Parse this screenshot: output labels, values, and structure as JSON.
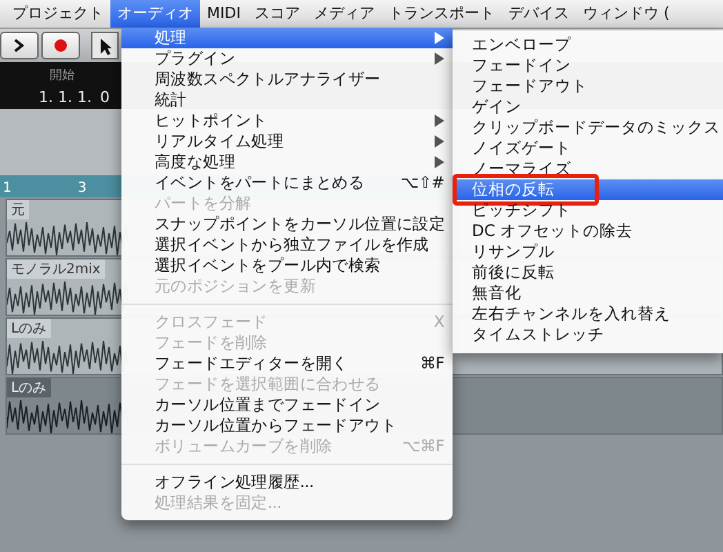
{
  "menubar": [
    {
      "label": "プロジェクト",
      "selected": false
    },
    {
      "label": "オーディオ",
      "selected": true
    },
    {
      "label": "MIDI",
      "selected": false
    },
    {
      "label": "スコア",
      "selected": false
    },
    {
      "label": "メディア",
      "selected": false
    },
    {
      "label": "トランスポート",
      "selected": false
    },
    {
      "label": "デバイス",
      "selected": false
    },
    {
      "label": "ウィンドウ (",
      "selected": false
    }
  ],
  "transport": {
    "start_label": "開始",
    "start_value": "1. 1. 1.",
    "start_ticks": "0"
  },
  "ruler": [
    "1",
    "3"
  ],
  "tracks": [
    {
      "label": "元",
      "selected": false
    },
    {
      "label": "モノラル2mix",
      "selected": false
    },
    {
      "label": "Lのみ",
      "selected": false
    },
    {
      "label": "Lのみ",
      "selected": true
    }
  ],
  "audio_menu": [
    {
      "kind": "item",
      "label": "処理",
      "has_submenu": true,
      "disabled": false,
      "selected": true
    },
    {
      "kind": "item",
      "label": "プラグイン",
      "has_submenu": true,
      "disabled": false,
      "selected": false
    },
    {
      "kind": "item",
      "label": "周波数スペクトルアナライザー",
      "has_submenu": false,
      "disabled": false,
      "selected": false
    },
    {
      "kind": "item",
      "label": "統計",
      "has_submenu": false,
      "disabled": false,
      "selected": false
    },
    {
      "kind": "item",
      "label": "ヒットポイント",
      "has_submenu": true,
      "disabled": false,
      "selected": false
    },
    {
      "kind": "item",
      "label": "リアルタイム処理",
      "has_submenu": true,
      "disabled": false,
      "selected": false
    },
    {
      "kind": "item",
      "label": "高度な処理",
      "has_submenu": true,
      "disabled": false,
      "selected": false
    },
    {
      "kind": "item",
      "label": "イベントをパートにまとめる",
      "shortcut": "⌥⇧#",
      "has_submenu": false,
      "disabled": false,
      "selected": false
    },
    {
      "kind": "item",
      "label": "パートを分解",
      "has_submenu": false,
      "disabled": true,
      "selected": false
    },
    {
      "kind": "item",
      "label": "スナップポイントをカーソル位置に設定",
      "has_submenu": false,
      "disabled": false,
      "selected": false
    },
    {
      "kind": "item",
      "label": "選択イベントから独立ファイルを作成",
      "has_submenu": false,
      "disabled": false,
      "selected": false
    },
    {
      "kind": "item",
      "label": "選択イベントをプール内で検索",
      "has_submenu": false,
      "disabled": false,
      "selected": false
    },
    {
      "kind": "item",
      "label": "元のポジションを更新",
      "has_submenu": false,
      "disabled": true,
      "selected": false
    },
    {
      "kind": "separator"
    },
    {
      "kind": "item",
      "label": "クロスフェード",
      "shortcut": "X",
      "has_submenu": false,
      "disabled": true,
      "selected": false
    },
    {
      "kind": "item",
      "label": "フェードを削除",
      "has_submenu": false,
      "disabled": true,
      "selected": false
    },
    {
      "kind": "item",
      "label": "フェードエディターを開く",
      "shortcut": "⌘F",
      "has_submenu": false,
      "disabled": false,
      "selected": false
    },
    {
      "kind": "item",
      "label": "フェードを選択範囲に合わせる",
      "has_submenu": false,
      "disabled": true,
      "selected": false
    },
    {
      "kind": "item",
      "label": "カーソル位置までフェードイン",
      "has_submenu": false,
      "disabled": false,
      "selected": false
    },
    {
      "kind": "item",
      "label": "カーソル位置からフェードアウト",
      "has_submenu": false,
      "disabled": false,
      "selected": false
    },
    {
      "kind": "item",
      "label": "ボリュームカーブを削除",
      "shortcut": "⌥⌘F",
      "has_submenu": false,
      "disabled": true,
      "selected": false
    },
    {
      "kind": "separator"
    },
    {
      "kind": "item",
      "label": "オフライン処理履歴...",
      "has_submenu": false,
      "disabled": false,
      "selected": false
    },
    {
      "kind": "item",
      "label": "処理結果を固定...",
      "has_submenu": false,
      "disabled": true,
      "selected": false
    }
  ],
  "process_submenu": [
    {
      "label": "エンベロープ",
      "selected": false,
      "highlighted_frame": false
    },
    {
      "label": "フェードイン",
      "selected": false,
      "highlighted_frame": false
    },
    {
      "label": "フェードアウト",
      "selected": false,
      "highlighted_frame": false
    },
    {
      "label": "ゲイン",
      "selected": false,
      "highlighted_frame": false
    },
    {
      "label": "クリップボードデータのミックス",
      "selected": false,
      "highlighted_frame": false
    },
    {
      "label": "ノイズゲート",
      "selected": false,
      "highlighted_frame": false
    },
    {
      "label": "ノーマライズ",
      "selected": false,
      "highlighted_frame": false
    },
    {
      "label": "位相の反転",
      "selected": true,
      "highlighted_frame": true
    },
    {
      "label": "ピッチシフト",
      "selected": false,
      "highlighted_frame": false
    },
    {
      "label": "DC オフセットの除去",
      "selected": false,
      "highlighted_frame": false
    },
    {
      "label": "リサンプル",
      "selected": false,
      "highlighted_frame": false
    },
    {
      "label": "前後に反転",
      "selected": false,
      "highlighted_frame": false
    },
    {
      "label": "無音化",
      "selected": false,
      "highlighted_frame": false
    },
    {
      "label": "左右チャンネルを入れ替え",
      "selected": false,
      "highlighted_frame": false
    },
    {
      "label": "タイムストレッチ",
      "selected": false,
      "highlighted_frame": false
    }
  ]
}
